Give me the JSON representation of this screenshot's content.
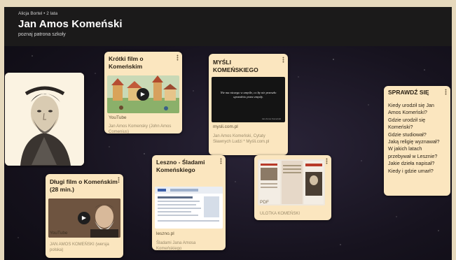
{
  "header": {
    "meta": "Alicja Bortel • 2 lata",
    "title": "Jan Amos Komeński",
    "subtitle": "poznaj patrona szkoły"
  },
  "cards": {
    "short_film": {
      "title": "Krótki film o Komeńskim",
      "source": "YouTube",
      "caption": "Jan Amos Komensky (John Amos Comenius)"
    },
    "thoughts": {
      "title": "MYŚLI KOMEŃSKIEGO",
      "quote": "Nie ma niczego w umyśle, co by nie przeszło uprzednio przez zmysły.",
      "quote_author": "Jan Amos Komeński",
      "source": "mysli.com.pl",
      "caption": "Jan Amos Komeński, Cytaty Sławnych Ludzi * Myśli.com.pl"
    },
    "leszno": {
      "title": "Leszno - Śladami Komeńskiego",
      "source": "leszno.pl",
      "caption": "Śladami Jana Amosa Komeńskiego"
    },
    "leaflet": {
      "source": "PDF",
      "caption": "ULOTKA KOMEŃSKI"
    },
    "long_film": {
      "title": "Długi film o Komeńskim (28 min.)",
      "source": "YouTube",
      "caption": "JAN AMOS KOMEŃSKI (wersja polska)"
    },
    "quiz": {
      "title": "SPRAWDŹ SIĘ",
      "lines": [
        "Kiedy urodził się Jan",
        "Amos Komeński?",
        "Gdzie urodził się",
        "Komeński?",
        "Gdzie studiował?",
        "Jaką religię wyznawał?",
        "W jakich latach",
        "przebywał w Lesznie?",
        "Jakie dzieła napisał?",
        "Kiedy i gdzie umarł?"
      ]
    }
  }
}
